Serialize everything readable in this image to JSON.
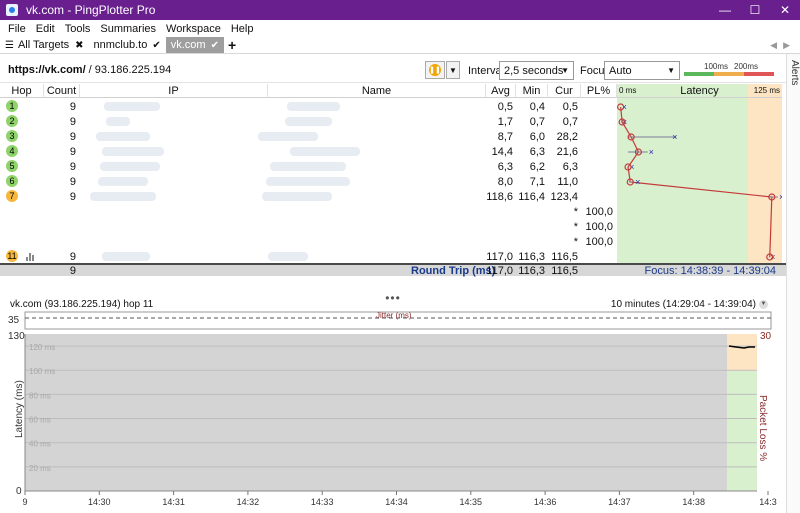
{
  "window": {
    "title": "vk.com - PingPlotter Pro"
  },
  "menu": [
    "File",
    "Edit",
    "Tools",
    "Summaries",
    "Workspace",
    "Help"
  ],
  "tabs": [
    {
      "label": "All Targets",
      "mark": "✖"
    },
    {
      "label": "nnmclub.to",
      "mark": "✔"
    },
    {
      "label": "vk.com",
      "mark": "✔"
    }
  ],
  "toolbar": {
    "target_url": "https://vk.com/",
    "target_ip": " / 93.186.225.194",
    "interval_label": "Interval",
    "interval_value": "2,5 seconds",
    "focus_label": "Focus",
    "focus_value": "Auto",
    "scale": {
      "t1": "100ms",
      "t2": "200ms"
    }
  },
  "alerts_label": "Alerts",
  "trace": {
    "headers": {
      "hop": "Hop",
      "count": "Count",
      "ip": "IP",
      "name": "Name",
      "avg": "Avg",
      "min": "Min",
      "cur": "Cur",
      "pl": "PL%",
      "latency": "Latency",
      "lat_min": "0 ms",
      "lat_max": "125 ms"
    },
    "rows": [
      {
        "hop": "1",
        "color": "green",
        "count": "9",
        "avg": "0,5",
        "min": "0,4",
        "cur": "0,5",
        "pl": ""
      },
      {
        "hop": "2",
        "color": "green",
        "count": "9",
        "avg": "1,7",
        "min": "0,7",
        "cur": "0,7",
        "pl": ""
      },
      {
        "hop": "3",
        "color": "green",
        "count": "9",
        "avg": "8,7",
        "min": "6,0",
        "cur": "28,2",
        "pl": ""
      },
      {
        "hop": "4",
        "color": "green",
        "count": "9",
        "avg": "14,4",
        "min": "6,3",
        "cur": "21,6",
        "pl": ""
      },
      {
        "hop": "5",
        "color": "green",
        "count": "9",
        "avg": "6,3",
        "min": "6,2",
        "cur": "6,3",
        "pl": ""
      },
      {
        "hop": "6",
        "color": "green",
        "count": "9",
        "avg": "8,0",
        "min": "7,1",
        "cur": "11,0",
        "pl": ""
      },
      {
        "hop": "7",
        "color": "orange",
        "count": "9",
        "avg": "118,6",
        "min": "116,4",
        "cur": "123,4",
        "pl": ""
      },
      {
        "hop": "",
        "color": "",
        "count": "",
        "avg": "",
        "min": "",
        "cur": "*",
        "pl": "100,0"
      },
      {
        "hop": "",
        "color": "",
        "count": "",
        "avg": "",
        "min": "",
        "cur": "*",
        "pl": "100,0"
      },
      {
        "hop": "",
        "color": "",
        "count": "",
        "avg": "",
        "min": "",
        "cur": "*",
        "pl": "100,0"
      },
      {
        "hop": "11",
        "color": "orange",
        "count": "9",
        "avg": "117,0",
        "min": "116,3",
        "cur": "116,5",
        "pl": ""
      }
    ],
    "summary": {
      "count": "9",
      "label": "Round Trip (ms)",
      "avg": "117,0",
      "min": "116,3",
      "cur": "116,5",
      "focus": "Focus: 14:38:39 - 14:39:04"
    }
  },
  "graph": {
    "header_left": "vk.com (93.186.225.194) hop 11",
    "header_right": "10 minutes (14:29:04 - 14:39:04)",
    "jitter_label": "Jitter (ms)",
    "jitter_max": "35",
    "ylabel": "Latency (ms)",
    "y2label": "Packet Loss %",
    "y_max": "130",
    "y_min": "0",
    "pl_max": "30",
    "gridlines": [
      "120 ms",
      "100 ms",
      "80 ms",
      "60 ms",
      "40 ms",
      "20 ms"
    ],
    "xticks": [
      "9",
      "14:30",
      "14:31",
      "14:32",
      "14:33",
      "14:34",
      "14:35",
      "14:36",
      "14:37",
      "14:38",
      "14:3"
    ]
  }
}
